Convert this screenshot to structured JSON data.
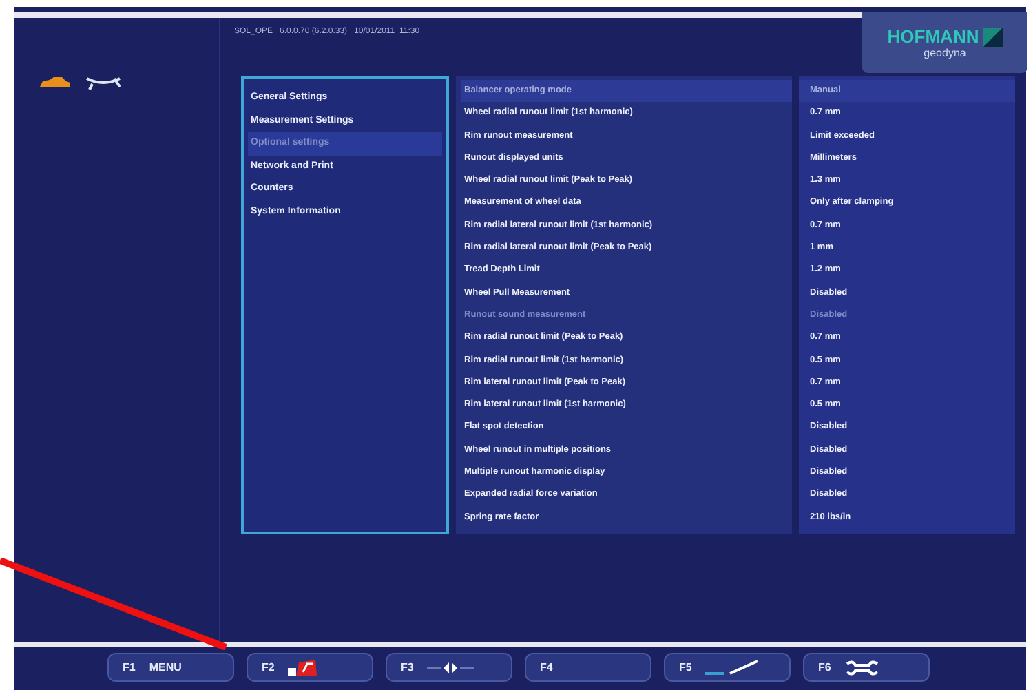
{
  "header": {
    "info": "SOL_OPE   6.0.0.70 (6.2.0.33)   10/01/2011  11:30",
    "logo": "HOFMANN",
    "logo_sub": "geodyna"
  },
  "settings_menu": [
    {
      "label": "General Settings",
      "selected": false
    },
    {
      "label": "Measurement Settings",
      "selected": false
    },
    {
      "label": "Optional settings",
      "selected": true
    },
    {
      "label": "Network and Print",
      "selected": false
    },
    {
      "label": "Counters",
      "selected": false
    },
    {
      "label": "System Information",
      "selected": false
    }
  ],
  "parameters": [
    {
      "name": "Balancer operating mode",
      "value": "Manual",
      "selected": true,
      "disabled": false
    },
    {
      "name": "Wheel radial runout limit (1st harmonic)",
      "value": "0.7 mm",
      "selected": false,
      "disabled": false
    },
    {
      "name": "Rim runout measurement",
      "value": "Limit exceeded",
      "selected": false,
      "disabled": false
    },
    {
      "name": "Runout displayed units",
      "value": "Millimeters",
      "selected": false,
      "disabled": false
    },
    {
      "name": "Wheel radial runout limit (Peak to Peak)",
      "value": "1.3 mm",
      "selected": false,
      "disabled": false
    },
    {
      "name": "Measurement of wheel data",
      "value": "Only after clamping",
      "selected": false,
      "disabled": false
    },
    {
      "name": "Rim radial lateral runout limit (1st harmonic)",
      "value": "0.7 mm",
      "selected": false,
      "disabled": false
    },
    {
      "name": "Rim radial lateral runout limit (Peak to Peak)",
      "value": "1 mm",
      "selected": false,
      "disabled": false
    },
    {
      "name": "Tread Depth Limit",
      "value": "1.2 mm",
      "selected": false,
      "disabled": false
    },
    {
      "name": "Wheel Pull Measurement",
      "value": "Disabled",
      "selected": false,
      "disabled": false
    },
    {
      "name": "Runout sound measurement",
      "value": "Disabled",
      "selected": false,
      "disabled": true
    },
    {
      "name": "Rim radial runout limit (Peak to Peak)",
      "value": "0.7 mm",
      "selected": false,
      "disabled": false
    },
    {
      "name": "Rim radial runout limit (1st harmonic)",
      "value": "0.5 mm",
      "selected": false,
      "disabled": false
    },
    {
      "name": "Rim lateral runout limit (Peak to Peak)",
      "value": "0.7 mm",
      "selected": false,
      "disabled": false
    },
    {
      "name": "Rim lateral runout limit (1st harmonic)",
      "value": "0.5 mm",
      "selected": false,
      "disabled": false
    },
    {
      "name": "Flat spot detection",
      "value": "Disabled",
      "selected": false,
      "disabled": false
    },
    {
      "name": "Wheel runout in multiple positions",
      "value": "Disabled",
      "selected": false,
      "disabled": false
    },
    {
      "name": "Multiple runout harmonic display",
      "value": "Disabled",
      "selected": false,
      "disabled": false
    },
    {
      "name": "Expanded radial force variation",
      "value": "Disabled",
      "selected": false,
      "disabled": false
    },
    {
      "name": "Spring rate factor",
      "value": "210 lbs/in",
      "selected": false,
      "disabled": false
    }
  ],
  "function_keys": [
    {
      "key": "F1",
      "kind": "text",
      "label": "MENU"
    },
    {
      "key": "F2",
      "kind": "icon"
    },
    {
      "key": "F3",
      "kind": "icon"
    },
    {
      "key": "F4",
      "kind": "blank"
    },
    {
      "key": "F5",
      "kind": "icon"
    },
    {
      "key": "F6",
      "kind": "icon"
    }
  ]
}
